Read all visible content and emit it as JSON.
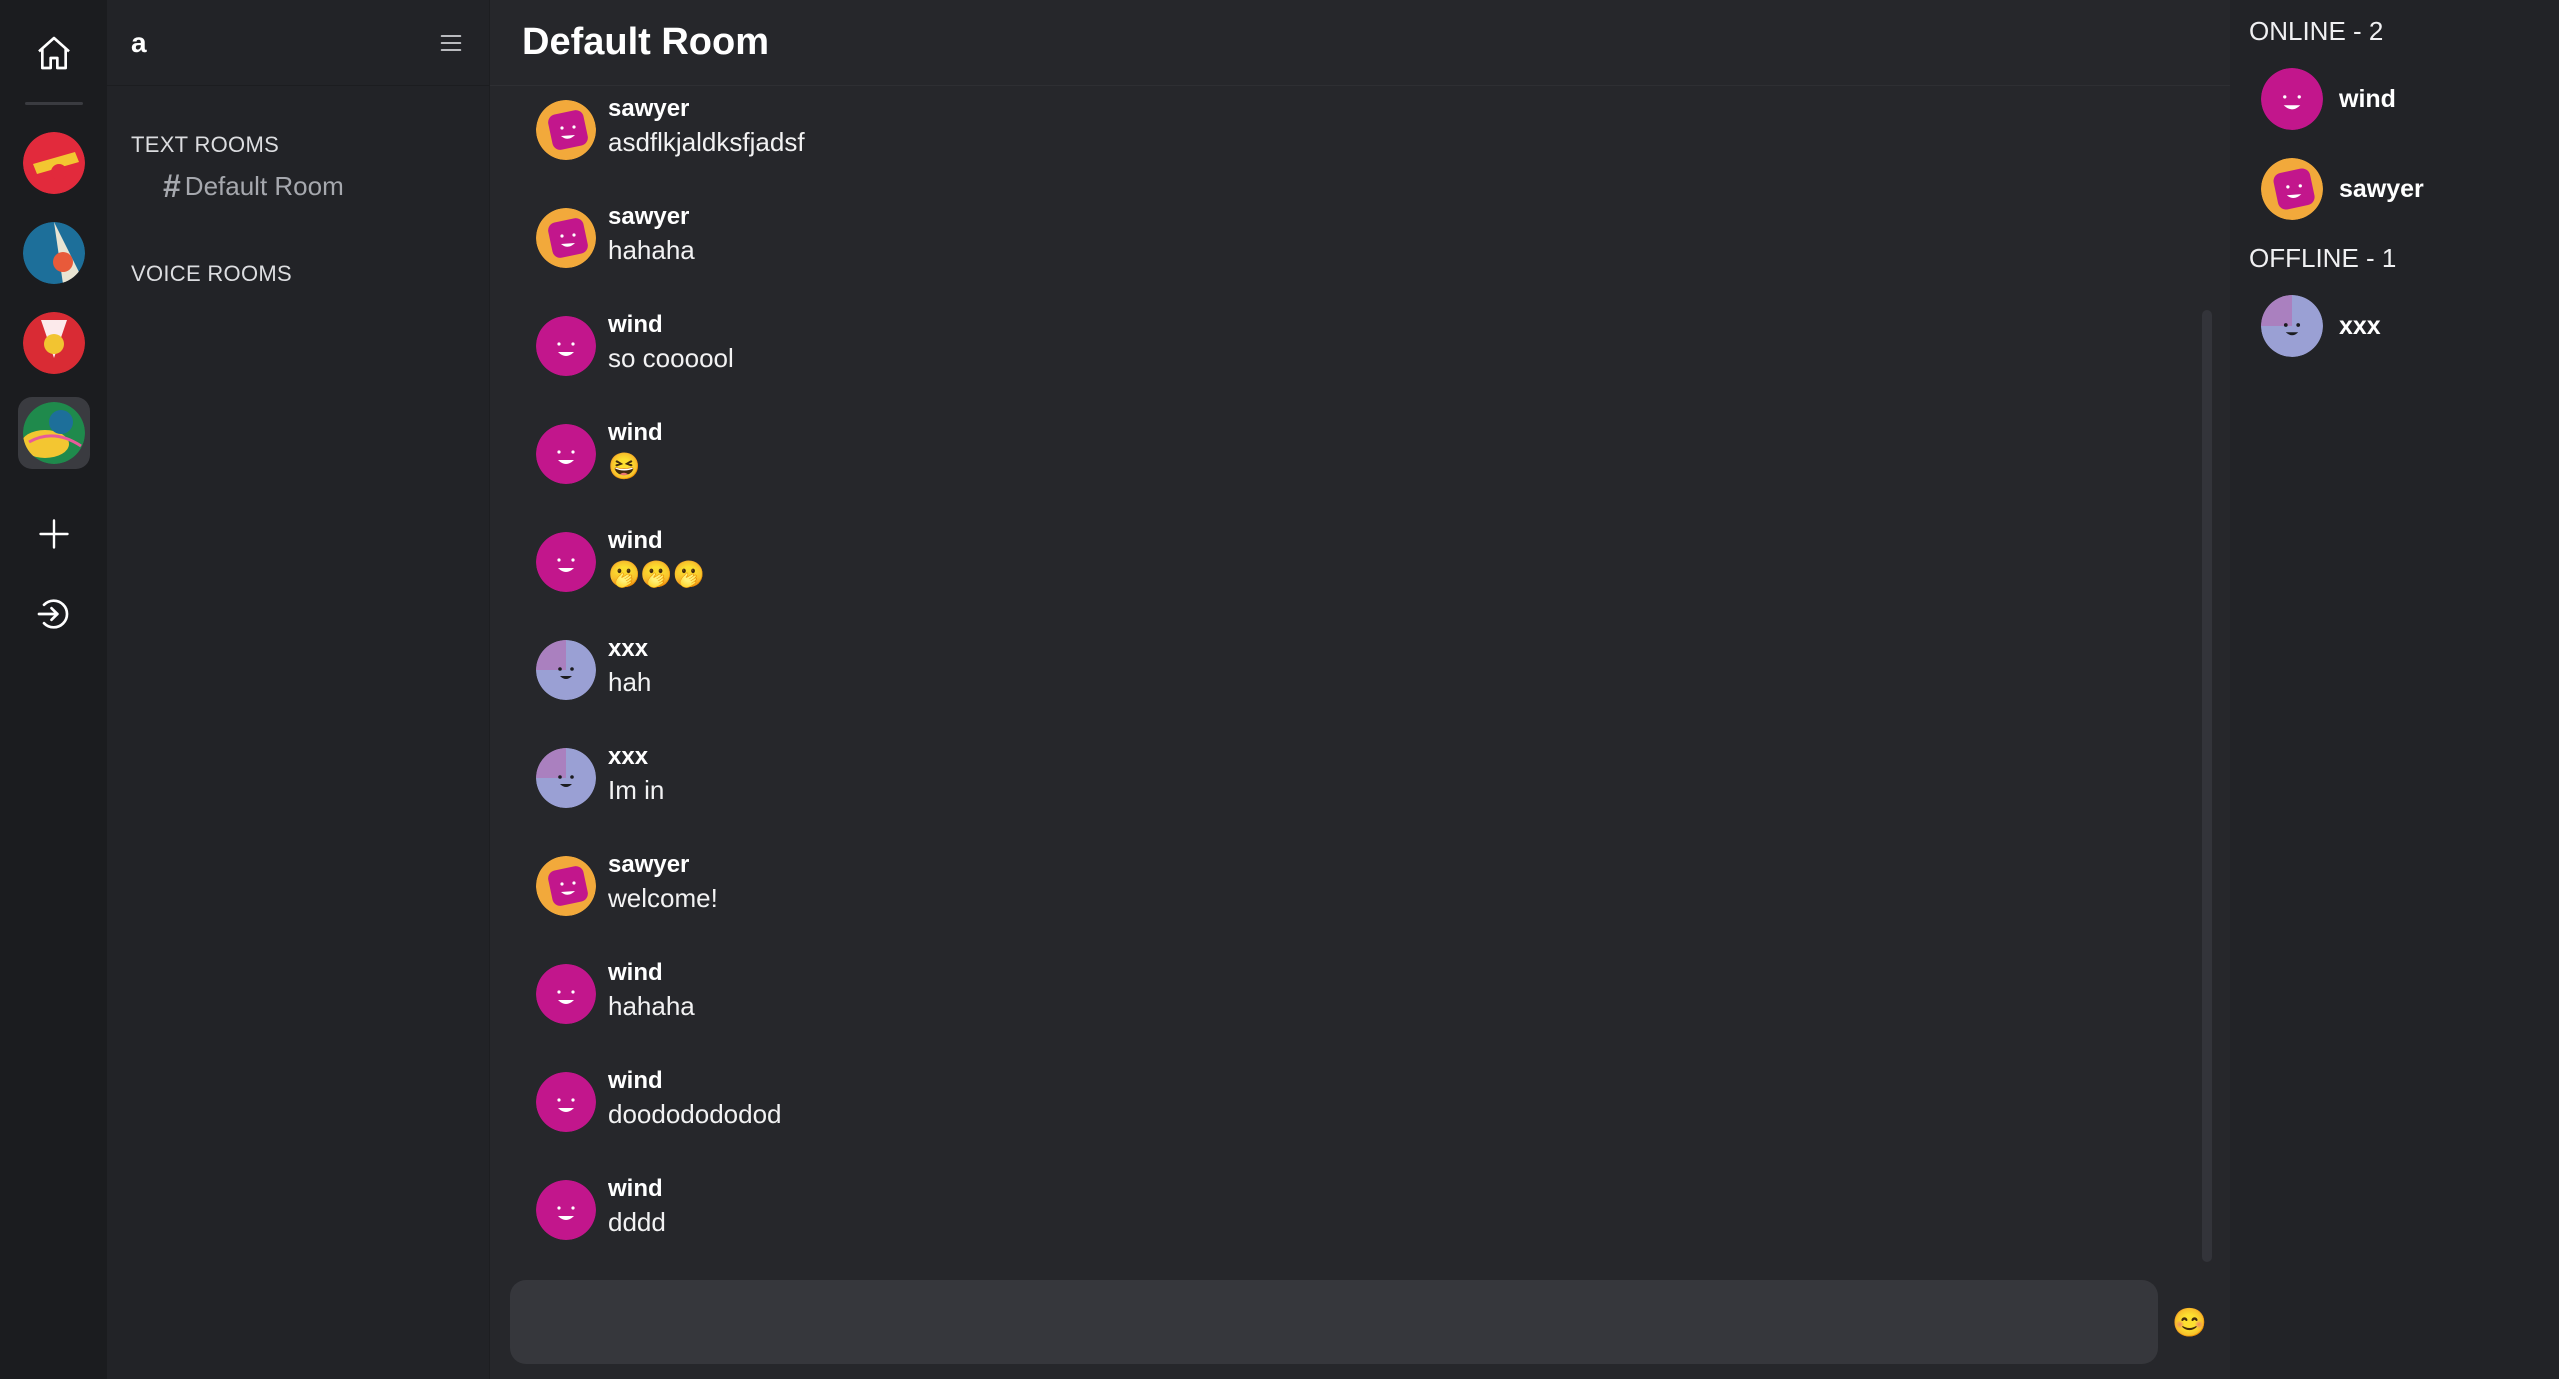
{
  "guild": {
    "name": "a"
  },
  "sidebar": {
    "text_rooms_label": "TEXT ROOMS",
    "voice_rooms_label": "VOICE ROOMS",
    "rooms": [
      {
        "name": "Default Room"
      }
    ]
  },
  "room": {
    "title": "Default Room"
  },
  "messages": [
    {
      "author": "sawyer",
      "text": "asdflkjaldksfjadsf"
    },
    {
      "author": "sawyer",
      "text": "hahaha"
    },
    {
      "author": "wind",
      "text": "so coooool"
    },
    {
      "author": "wind",
      "text": "😆"
    },
    {
      "author": "wind",
      "text": "🫢🫢🫢"
    },
    {
      "author": "xxx",
      "text": "hah"
    },
    {
      "author": "xxx",
      "text": "Im in"
    },
    {
      "author": "sawyer",
      "text": "welcome!"
    },
    {
      "author": "wind",
      "text": "hahaha"
    },
    {
      "author": "wind",
      "text": "doododododod"
    },
    {
      "author": "wind",
      "text": "dddd"
    }
  ],
  "composer": {
    "placeholder": ""
  },
  "members": {
    "online_label": "ONLINE - 2",
    "offline_label": "OFFLINE - 1",
    "online": [
      {
        "name": "wind"
      },
      {
        "name": "sawyer"
      }
    ],
    "offline": [
      {
        "name": "xxx"
      }
    ]
  },
  "icons": {
    "home": "home-icon",
    "menu": "hamburger-menu-icon",
    "add": "plus-icon",
    "logout": "logout-icon",
    "emoji": "emoji-icon",
    "hash": "hash-icon"
  },
  "colors": {
    "accent_magenta": "#c2168c",
    "accent_orange": "#f2a93b",
    "avatar_lavender": "#9aa0d4"
  }
}
